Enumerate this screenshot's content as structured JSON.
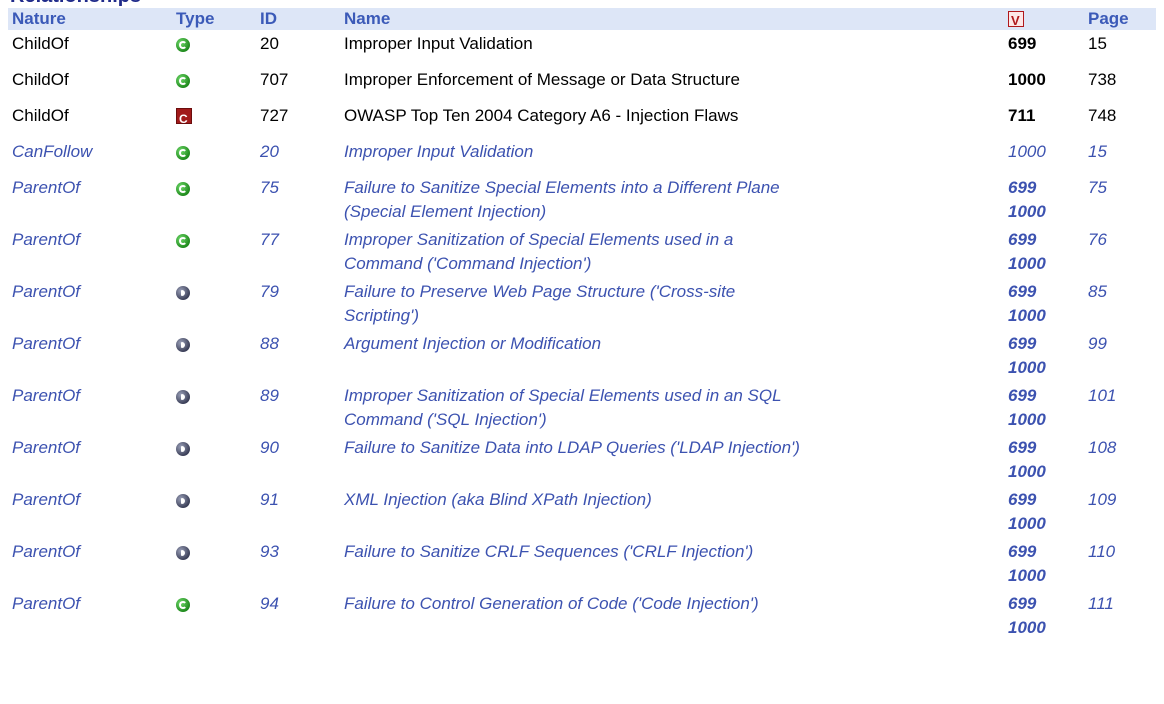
{
  "section_title": "Relationships",
  "columns": {
    "nature": "Nature",
    "type": "Type",
    "id": "ID",
    "name": "Name",
    "view_icon": "view-icon",
    "page": "Page"
  },
  "rows": [
    {
      "nature": "ChildOf",
      "type_icon": "class-icon",
      "id": "20",
      "name": "Improper Input Validation",
      "view": "699",
      "page": "15"
    },
    {
      "nature": "ChildOf",
      "type_icon": "class-icon",
      "id": "707",
      "name": "Improper Enforcement of Message or Data Structure",
      "view": "1000",
      "page": "738"
    },
    {
      "nature": "ChildOf",
      "type_icon": "category-icon",
      "id": "727",
      "name": "OWASP Top Ten 2004 Category A6 - Injection Flaws",
      "view": "711",
      "page": "748"
    },
    {
      "nature": "CanFollow",
      "type_icon": "class-icon",
      "id": "20",
      "name": "Improper Input Validation",
      "view": "1000",
      "page": "15"
    },
    {
      "nature": "ParentOf",
      "type_icon": "class-icon",
      "id": "75",
      "name_line1": "Failure to Sanitize Special Elements into a Different Plane",
      "name_line2": "(Special Element Injection)",
      "view_line1": "699",
      "view_line2": "1000",
      "page": "75"
    },
    {
      "nature": "ParentOf",
      "type_icon": "class-icon",
      "id": "77",
      "name_line1": "Improper Sanitization of Special Elements used in a",
      "name_line2": "Command ('Command Injection')",
      "view_line1": "699",
      "view_line2": "1000",
      "page": "76"
    },
    {
      "nature": "ParentOf",
      "type_icon": "base-icon",
      "id": "79",
      "name_line1": "Failure to Preserve Web Page Structure ('Cross-site",
      "name_line2": "Scripting')",
      "view_line1": "699",
      "view_line2": "1000",
      "page": "85"
    },
    {
      "nature": "ParentOf",
      "type_icon": "base-icon",
      "id": "88",
      "name_line1": "Argument Injection or Modification",
      "name_line2": "",
      "view_line1": "699",
      "view_line2": "1000",
      "page": "99"
    },
    {
      "nature": "ParentOf",
      "type_icon": "base-icon",
      "id": "89",
      "name_line1": "Improper Sanitization of Special Elements used in an SQL",
      "name_line2": "Command ('SQL Injection')",
      "view_line1": "699",
      "view_line2": "1000",
      "page": "101"
    },
    {
      "nature": "ParentOf",
      "type_icon": "base-icon",
      "id": "90",
      "name_line1": "Failure to Sanitize Data into LDAP Queries ('LDAP Injection')",
      "name_line2": "",
      "view_line1": "699",
      "view_line2": "1000",
      "page": "108"
    },
    {
      "nature": "ParentOf",
      "type_icon": "base-icon",
      "id": "91",
      "name_line1": "XML Injection (aka Blind XPath Injection)",
      "name_line2": "",
      "view_line1": "699",
      "view_line2": "1000",
      "page": "109"
    },
    {
      "nature": "ParentOf",
      "type_icon": "base-icon",
      "id": "93",
      "name_line1": "Failure to Sanitize CRLF Sequences ('CRLF Injection')",
      "name_line2": "",
      "view_line1": "699",
      "view_line2": "1000",
      "page": "110"
    },
    {
      "nature": "ParentOf",
      "type_icon": "class-icon",
      "id": "94",
      "name_line1": "Failure to Control Generation of Code ('Code Injection')",
      "name_line2": "",
      "view_line1": "699",
      "view_line2": "1000",
      "page": "111"
    }
  ]
}
